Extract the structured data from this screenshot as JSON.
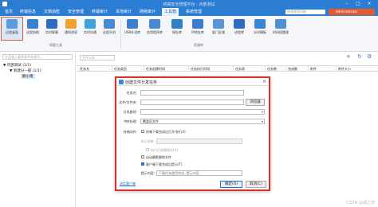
{
  "window": {
    "title": "终端安全管理平台 - 内部测试",
    "minimize_icon": "minimize-icon",
    "maximize_icon": "maximize-icon",
    "close_icon": "close-icon"
  },
  "menubar": {
    "items": [
      {
        "label": "首页"
      },
      {
        "label": "终端信息"
      },
      {
        "label": "文档加密"
      },
      {
        "label": "安全管理"
      },
      {
        "label": "终端审计"
      },
      {
        "label": "本地审计"
      },
      {
        "label": "网络审计"
      },
      {
        "label": "工具箱"
      },
      {
        "label": "系统管理"
      }
    ],
    "active_index": 7,
    "search_placeholder": "快速查找功能",
    "user": "Administrator"
  },
  "ribbon": {
    "groups": [
      {
        "label": "网管工具",
        "buttons": [
          {
            "label": "远程桌面",
            "icon": "remote-desktop-icon"
          },
          {
            "label": "远程协助",
            "icon": "remote-assist-icon"
          },
          {
            "label": "实时屏幕",
            "icon": "screen-icon"
          },
          {
            "label": "通知消息",
            "icon": "message-icon"
          },
          {
            "label": "实时沟通",
            "icon": "chat-icon"
          },
          {
            "label": "远程开机",
            "icon": "power-icon"
          }
        ]
      },
      {
        "label": "资源库",
        "buttons": [
          {
            "label": "USB外设库",
            "icon": "usb-icon"
          },
          {
            "label": "应用程序库",
            "icon": "app-icon"
          },
          {
            "label": "网址库",
            "icon": "web-icon"
          },
          {
            "label": "IP地址库",
            "icon": "ip-icon"
          },
          {
            "label": "部门区域",
            "icon": "region-icon"
          },
          {
            "label": "进程库",
            "icon": "process-icon"
          },
          {
            "label": "水印模板",
            "icon": "watermark-icon"
          },
          {
            "label": "时间段管理",
            "icon": "time-icon"
          }
        ]
      }
    ]
  },
  "tree": {
    "search_placeholder": "在此输入要搜索的关键字...",
    "nodes": [
      {
        "label": "▼ 内部测试 (1/1)"
      },
      {
        "label": "▼ 新建分一部 (1/1)"
      },
      {
        "label": "静小南"
      }
    ]
  },
  "main": {
    "search_placeholder": "文件分发",
    "columns": [
      "任务名",
      "任务类型",
      "任务创建时间",
      "任务执行时间",
      "任务表",
      "任务数",
      "完成数",
      "附件",
      "附件大小"
    ]
  },
  "dialog": {
    "title": "创建文件分发任务",
    "fields": {
      "task_name": {
        "label": "任务名:",
        "value": ""
      },
      "file_path": {
        "label": "文件/文件夹:",
        "value": ""
      },
      "browse": "浏览器",
      "dist_path": {
        "label": "分发路径:",
        "value": ""
      },
      "conflict": {
        "label": "冲突处理:",
        "value": "覆盖旧文件"
      },
      "after": {
        "label": "终端动作:"
      },
      "open_after": "终端下载完成后打开/执行(I)",
      "exec_params": {
        "label": "执行参数:",
        "value": ""
      },
      "run_hidden": "执行后隐藏模式(H)",
      "silent_kill": "自动静默删除文件",
      "notify": "客户端下载完成后提示(T)",
      "notify_text": {
        "label": "提示内容:",
        "placeholder": "下载任务使用完成, 提示内容"
      }
    },
    "link": "选定客户端",
    "ok": "确定(O)",
    "cancel": "取消(C)"
  },
  "watermark": "CSDN @城之感"
}
